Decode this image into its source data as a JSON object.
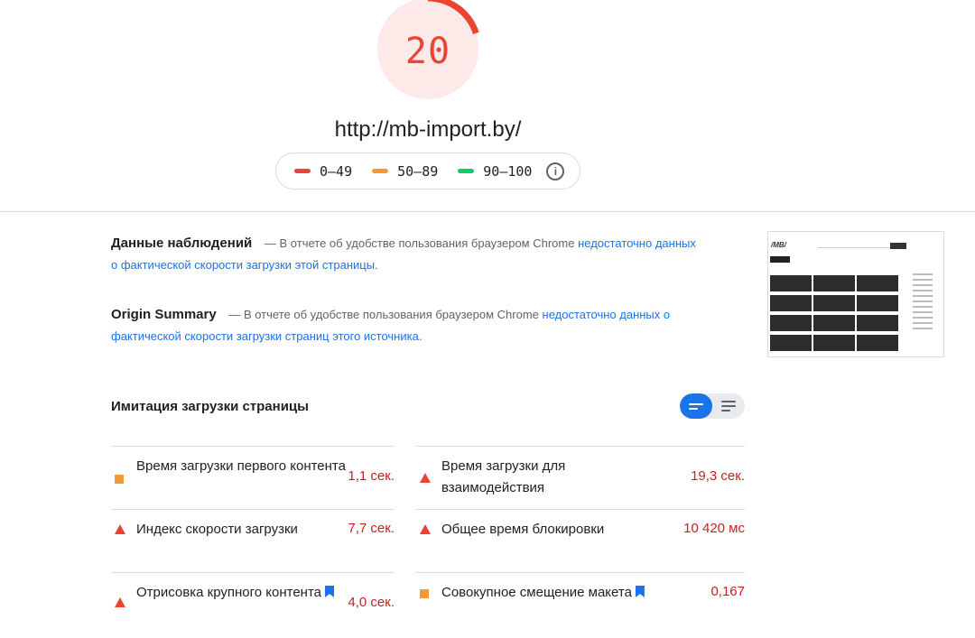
{
  "report": {
    "score": "20",
    "score_value": 20,
    "score_color": "#eb4335",
    "url": "http://mb-import.by/"
  },
  "legend": [
    {
      "label": "0–49",
      "color": "#eb4335"
    },
    {
      "label": "50–89",
      "color": "#f29b33"
    },
    {
      "label": "90–100",
      "color": "#0cce6b"
    }
  ],
  "field_data": {
    "title": "Данные наблюдений",
    "dash_text": "— В отчете об удобстве пользования браузером Chrome",
    "link_text": "недостаточно данных о фактической скорости загрузки этой страницы",
    "end": "."
  },
  "origin_summary": {
    "title": "Origin Summary",
    "dash_text": "— В отчете об удобстве пользования браузером Chrome",
    "link_text": "недостаточно данных о фактической скорости загрузки страниц этого источника",
    "end": "."
  },
  "lab": {
    "title": "Имитация загрузки страницы",
    "metrics_left": [
      {
        "name": "Время загрузки первого контента",
        "value": "1,1 сек.",
        "status": "average"
      },
      {
        "name": "Индекс скорости загрузки",
        "value": "7,7 сек.",
        "status": "fail"
      },
      {
        "name": "Отрисовка крупного контента",
        "value": "4,0 сек.",
        "status": "fail"
      }
    ],
    "metrics_right": [
      {
        "name": "Время загрузки для взаимодействия",
        "value": "19,3 сек.",
        "status": "fail"
      },
      {
        "name": "Общее время блокировки",
        "value": "10 420 мс",
        "status": "fail"
      },
      {
        "name": "Совокупное смещение макета",
        "value": "0,167",
        "status": "average"
      }
    ]
  },
  "colors": {
    "fail": "#eb4335",
    "average": "#f29b33",
    "pass": "#0cce6b",
    "link": "#1a73e8"
  }
}
